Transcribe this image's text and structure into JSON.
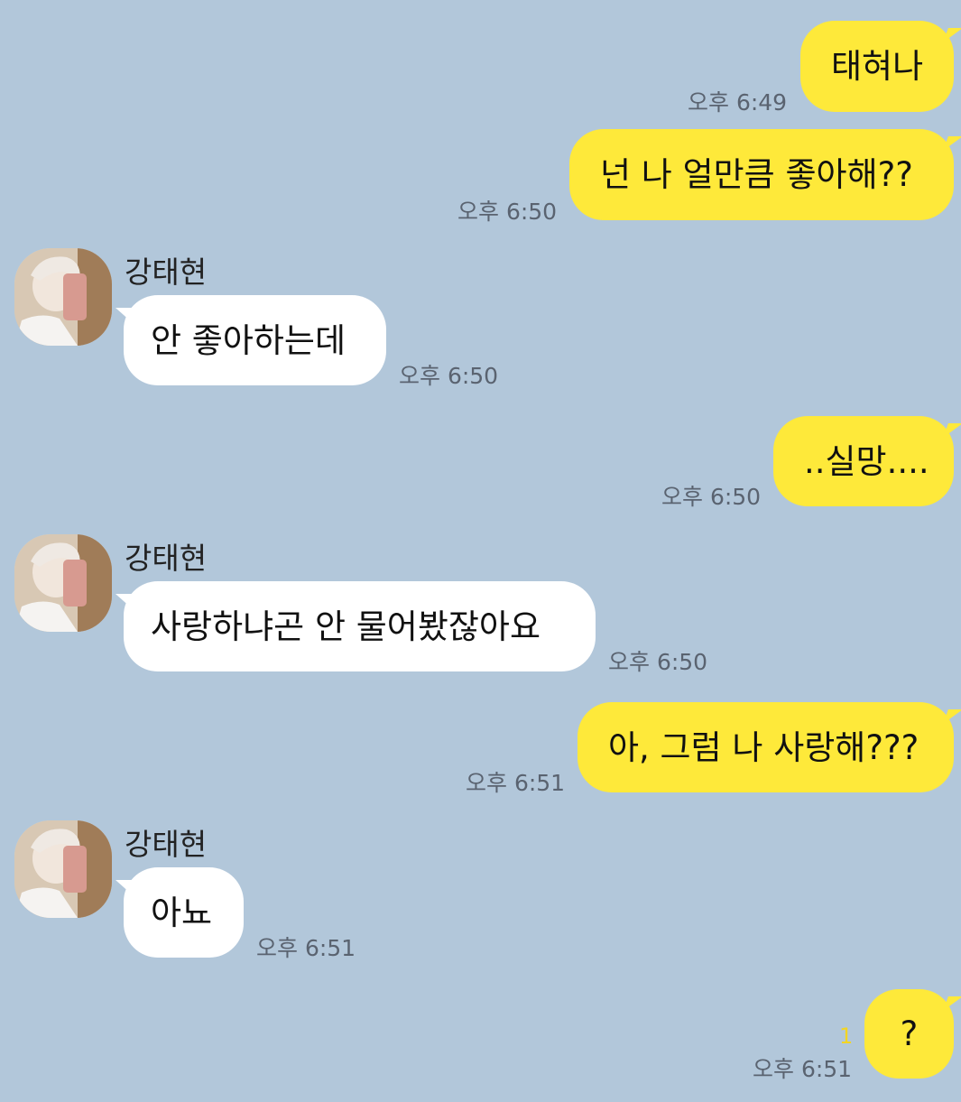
{
  "colors": {
    "background": "#b2c7da",
    "my_bubble": "#fee93a",
    "their_bubble": "#ffffff",
    "timestamp": "#5a6370",
    "unread": "#f3d523"
  },
  "contact": {
    "name": "강태현",
    "avatar_icon": "profile-photo"
  },
  "messages": [
    {
      "from": "me",
      "text": "태혀나",
      "time": "오후 6:49"
    },
    {
      "from": "me",
      "text": "넌 나 얼만큼 좋아해??",
      "time": "오후 6:50"
    },
    {
      "from": "them",
      "sender": "강태현",
      "text": "안 좋아하는데",
      "time": "오후 6:50"
    },
    {
      "from": "me",
      "text": "..실망....",
      "time": "오후 6:50"
    },
    {
      "from": "them",
      "sender": "강태현",
      "text": "사랑하냐곤 안 물어봤잖아요",
      "time": "오후 6:50"
    },
    {
      "from": "me",
      "text": "아, 그럼 나 사랑해???",
      "time": "오후 6:51"
    },
    {
      "from": "them",
      "sender": "강태현",
      "text": "아뇨",
      "time": "오후 6:51"
    },
    {
      "from": "me",
      "text": "?",
      "time": "오후 6:51",
      "unread": "1"
    }
  ]
}
